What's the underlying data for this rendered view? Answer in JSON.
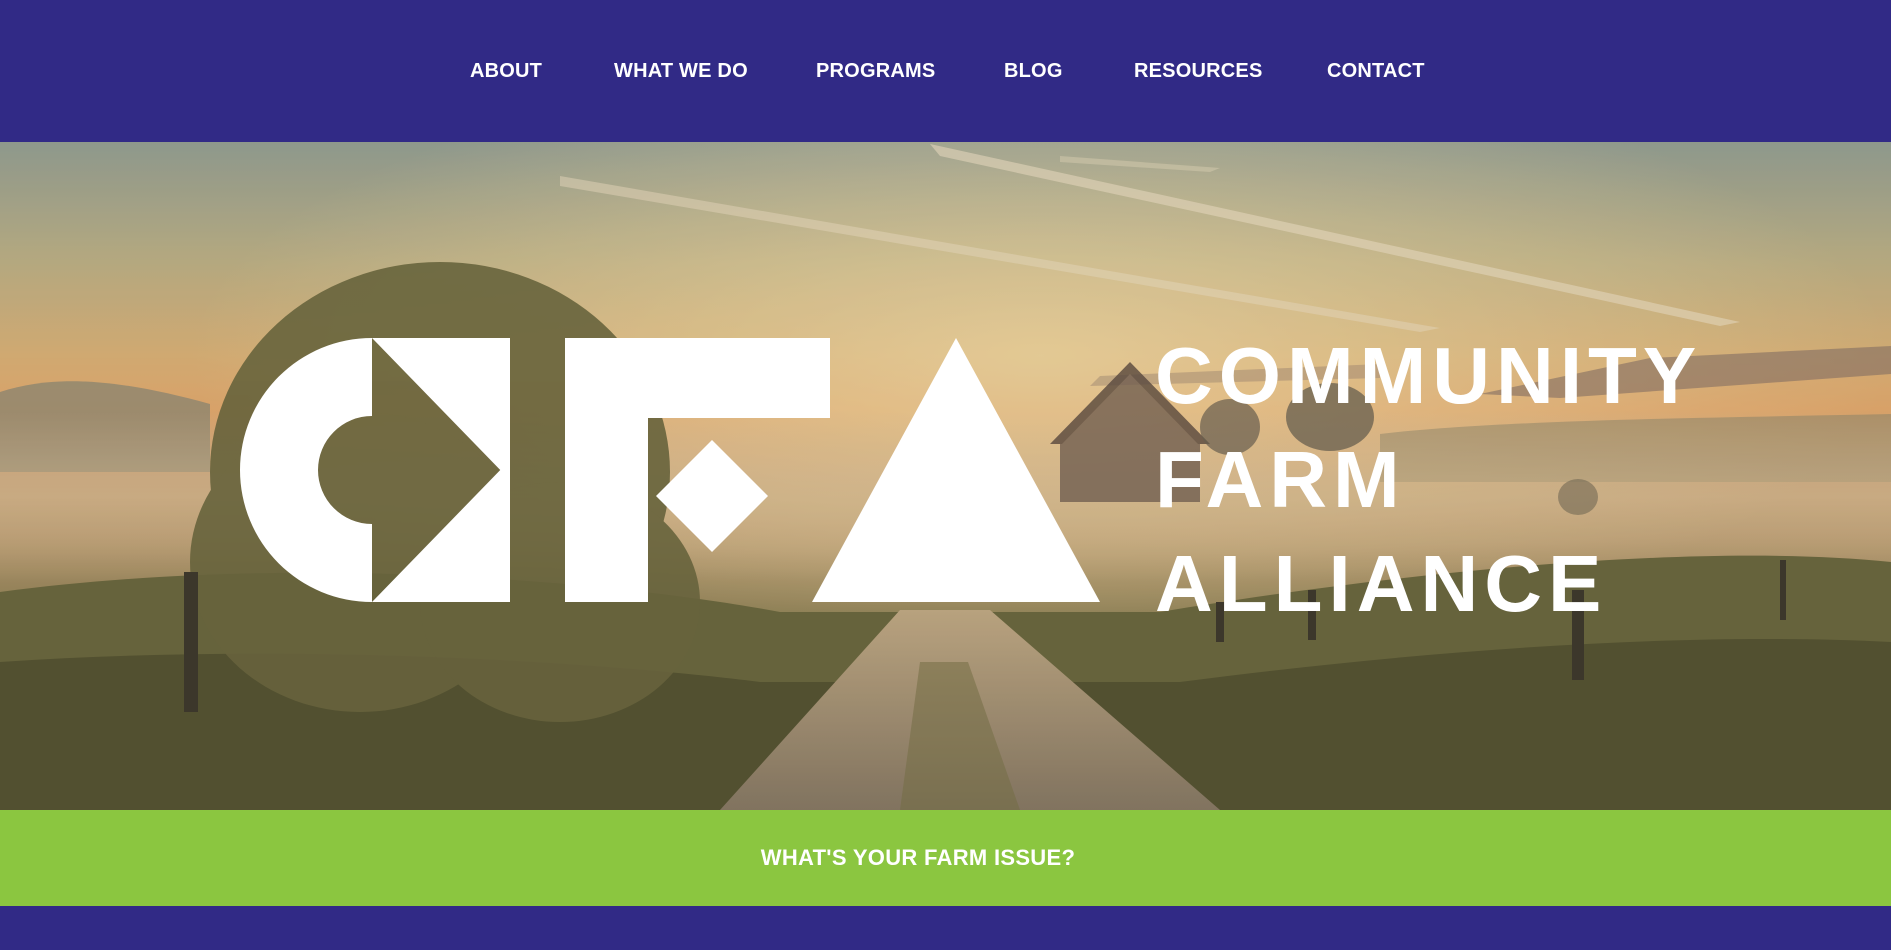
{
  "nav": {
    "items": [
      {
        "label": "ABOUT"
      },
      {
        "label": "WHAT WE DO"
      },
      {
        "label": "PROGRAMS"
      },
      {
        "label": "BLOG"
      },
      {
        "label": "RESOURCES"
      },
      {
        "label": "CONTACT"
      }
    ]
  },
  "hero": {
    "background": "misty farm road at sunrise",
    "logo": {
      "mark": "CFA",
      "lines": [
        "COMMUNITY",
        "FARM",
        "ALLIANCE"
      ]
    }
  },
  "cta": {
    "label": "WHAT'S YOUR FARM ISSUE?"
  },
  "colors": {
    "nav_bg": "#312a86",
    "cta_bg": "#8bc640",
    "text": "#ffffff"
  }
}
